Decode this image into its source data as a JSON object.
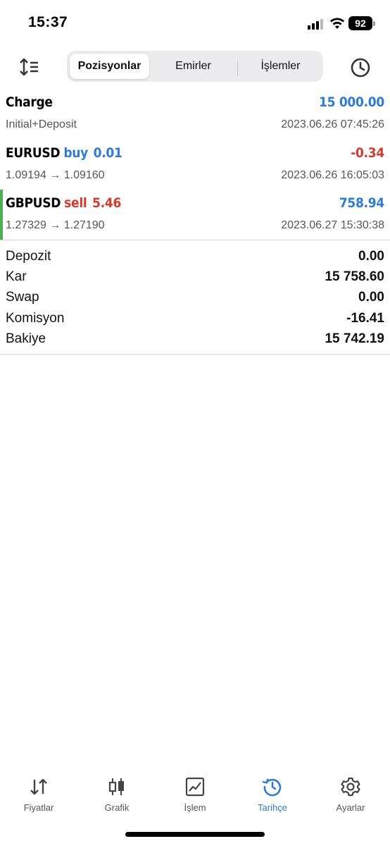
{
  "status_bar": {
    "time": "15:37",
    "battery": "92"
  },
  "toolbar": {
    "segments": [
      {
        "label": "Pozisyonlar",
        "active": true
      },
      {
        "label": "Emirler",
        "active": false
      },
      {
        "label": "İşlemler",
        "active": false
      }
    ],
    "sort_icon": "sort-icon",
    "history_icon": "clock-icon"
  },
  "deals": [
    {
      "symbol": "Charge",
      "side": "",
      "volume": "",
      "amount": "15 000.00",
      "amount_color": "#2e7bd6",
      "detail": "Initial+Deposit",
      "time": "2023.06.26 07:45:26"
    },
    {
      "symbol": "EURUSD",
      "side": "buy",
      "volume": "0.01",
      "amount": "-0.34",
      "amount_color": "#d63a2f",
      "detail": "1.09194 → 1.09160",
      "time": "2023.06.26 16:05:03"
    },
    {
      "symbol": "GBPUSD",
      "side": "sell",
      "volume": "5.46",
      "amount": "758.94",
      "amount_color": "#2e7bd6",
      "detail": "1.27329 → 1.27190",
      "time": "2023.06.27 15:30:38"
    }
  ],
  "summary": [
    {
      "label": "Depozit",
      "value": "0.00"
    },
    {
      "label": "Kar",
      "value": "15 758.60"
    },
    {
      "label": "Swap",
      "value": "0.00"
    },
    {
      "label": "Komisyon",
      "value": "-16.41"
    },
    {
      "label": "Bakiye",
      "value": "15 742.19"
    }
  ],
  "tabbar": [
    {
      "label": "Fiyatlar",
      "icon": "quotes-icon",
      "active": false
    },
    {
      "label": "Grafik",
      "icon": "candlestick-icon",
      "active": false
    },
    {
      "label": "İşlem",
      "icon": "trade-chart-icon",
      "active": false
    },
    {
      "label": "Tarihçe",
      "icon": "history-icon",
      "active": true
    },
    {
      "label": "Ayarlar",
      "icon": "gear-icon",
      "active": false
    }
  ],
  "colors": {
    "accent": "#2e7bd6",
    "loss": "#d63a2f",
    "profit_bar": "#4caf50"
  }
}
